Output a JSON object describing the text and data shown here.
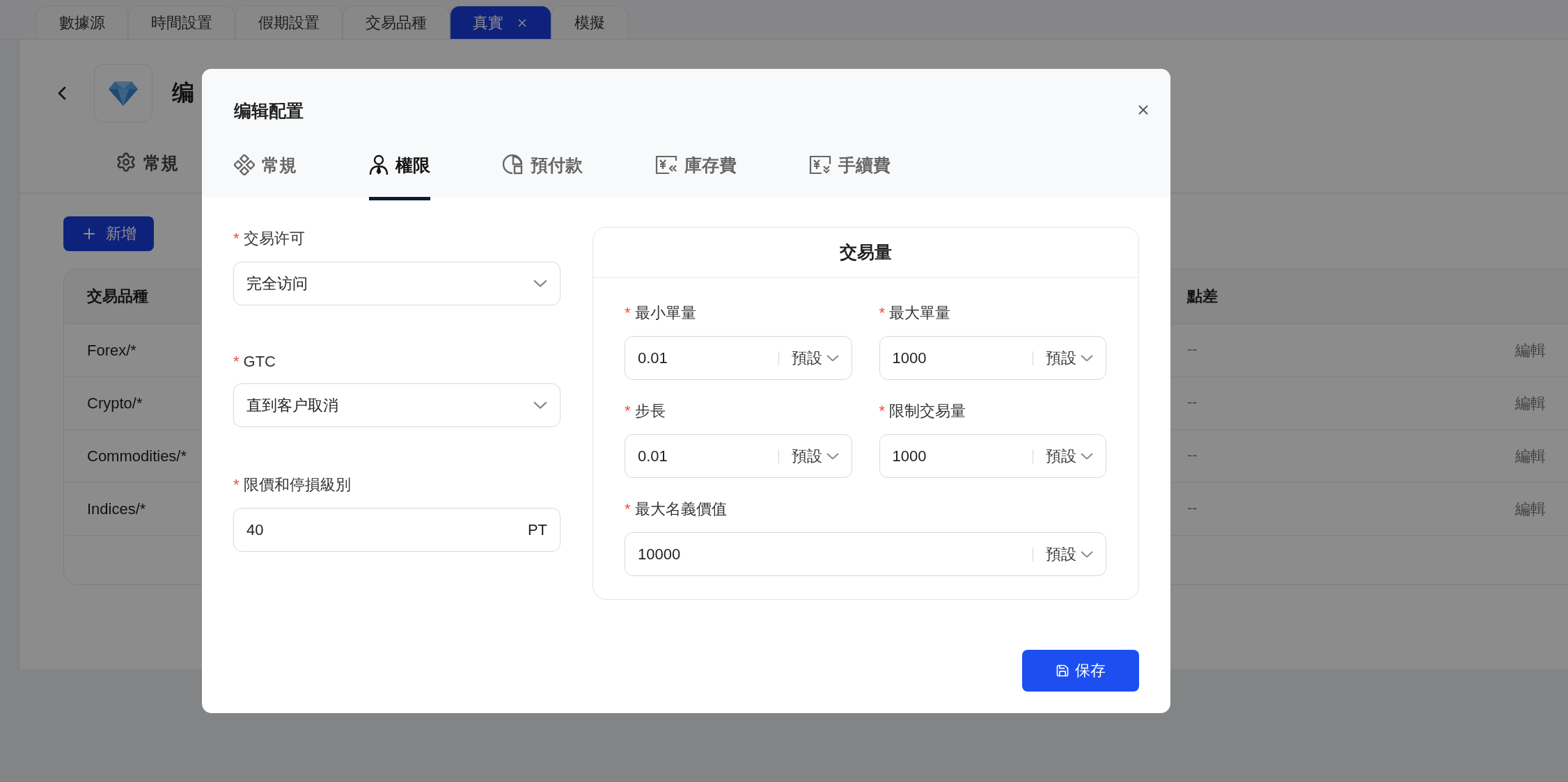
{
  "top_tabs": [
    {
      "label": "數據源",
      "selected": false,
      "closable": false
    },
    {
      "label": "時間設置",
      "selected": false,
      "closable": false
    },
    {
      "label": "假期設置",
      "selected": false,
      "closable": false
    },
    {
      "label": "交易品種",
      "selected": false,
      "closable": false
    },
    {
      "label": "真實",
      "selected": true,
      "closable": true
    },
    {
      "label": "模擬",
      "selected": false,
      "closable": false
    }
  ],
  "page": {
    "title": "编",
    "tabs": [
      {
        "label": "常規"
      }
    ],
    "add_button": "新增",
    "table": {
      "columns": [
        {
          "label": "交易品種"
        },
        {
          "label": "點差"
        }
      ],
      "rows": [
        {
          "symbol": "Forex/*",
          "spread": "--",
          "action": "編輯"
        },
        {
          "symbol": "Crypto/*",
          "spread": "--",
          "action": "編輯"
        },
        {
          "symbol": "Commodities/*",
          "spread": "--",
          "action": "編輯"
        },
        {
          "symbol": "Indices/*",
          "spread": "--",
          "action": "編輯"
        }
      ]
    }
  },
  "dialog": {
    "title": "编辑配置",
    "tabs": [
      {
        "label": "常規",
        "selected": false
      },
      {
        "label": "權限",
        "selected": true
      },
      {
        "label": "預付款",
        "selected": false
      },
      {
        "label": "庫存費",
        "selected": false
      },
      {
        "label": "手續費",
        "selected": false
      }
    ],
    "left_fields": [
      {
        "kind": "select",
        "label": "交易许可",
        "required_mark": "*",
        "value": "完全访问"
      },
      {
        "kind": "select",
        "label": "GTC",
        "required_mark": "*",
        "value": "直到客户取消"
      },
      {
        "kind": "input",
        "label": "限價和停損級別",
        "required_mark": "*",
        "value": "40",
        "suffix": "PT"
      }
    ],
    "volume_card": {
      "title": "交易量",
      "fields": [
        {
          "label": "最小單量",
          "required_mark": "*",
          "value": "0.01",
          "unit": "預設",
          "wide": false
        },
        {
          "label": "最大單量",
          "required_mark": "*",
          "value": "1000",
          "unit": "預設",
          "wide": false
        },
        {
          "label": "步長",
          "required_mark": "*",
          "value": "0.01",
          "unit": "預設",
          "wide": false
        },
        {
          "label": "限制交易量",
          "required_mark": "*",
          "value": "1000",
          "unit": "預設",
          "wide": false
        },
        {
          "label": "最大名義價值",
          "required_mark": "*",
          "value": "10000",
          "unit": "預設",
          "wide": true
        }
      ]
    },
    "save_button": "保存"
  }
}
